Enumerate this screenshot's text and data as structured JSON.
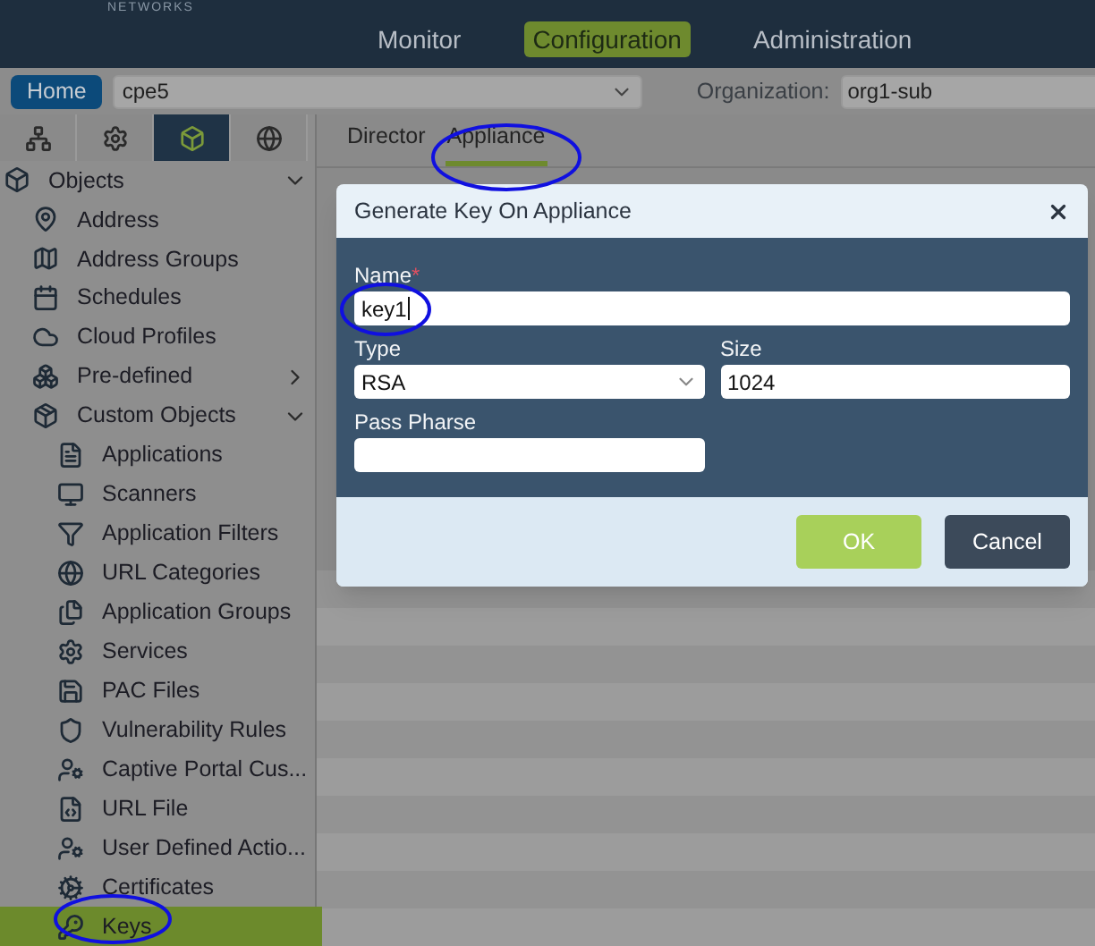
{
  "header": {
    "logo_text": "NETWORKS",
    "menu": [
      {
        "label": "Monitor",
        "selected": false
      },
      {
        "label": "Configuration",
        "selected": true
      },
      {
        "label": "Administration",
        "selected": false
      }
    ]
  },
  "toolbar": {
    "home": "Home",
    "device": "cpe5",
    "organization_label": "Organization:",
    "organization": "org1-sub"
  },
  "sidebar": {
    "tabs": [
      {
        "selected": false
      },
      {
        "selected": false
      },
      {
        "selected": true
      },
      {
        "selected": false
      }
    ],
    "tree": [
      {
        "label": "Objects",
        "expanded": true,
        "children": [
          {
            "label": "Address"
          },
          {
            "label": "Address Groups"
          },
          {
            "label": "Schedules"
          },
          {
            "label": "Cloud Profiles"
          },
          {
            "label": "Pre-defined",
            "expanded": false
          },
          {
            "label": "Custom Objects",
            "expanded": true,
            "children": [
              {
                "label": "Applications",
                "selected": false
              },
              {
                "label": "Scanners",
                "selected": false
              },
              {
                "label": "Application Filters",
                "selected": false
              },
              {
                "label": "URL Categories",
                "selected": false
              },
              {
                "label": "Application Groups",
                "selected": false
              },
              {
                "label": "Services",
                "selected": false
              },
              {
                "label": "PAC Files",
                "selected": false
              },
              {
                "label": "Vulnerability Rules",
                "selected": false
              },
              {
                "label": "Captive Portal Cus...",
                "selected": false
              },
              {
                "label": "URL File",
                "selected": false
              },
              {
                "label": "User Defined Actio...",
                "selected": false
              },
              {
                "label": "Certificates",
                "selected": false
              },
              {
                "label": "Keys",
                "selected": true
              }
            ]
          }
        ]
      }
    ]
  },
  "content": {
    "tabs": [
      {
        "label": "Director",
        "selected": false
      },
      {
        "label": "Appliance",
        "selected": true
      }
    ]
  },
  "dialog": {
    "title": "Generate Key On Appliance",
    "name": {
      "label": "Name",
      "required_mark": "*",
      "value": "key1"
    },
    "type": {
      "label": "Type",
      "value": "RSA"
    },
    "size": {
      "label": "Size",
      "value": "1024"
    },
    "pass_phrase": {
      "label": "Pass Pharse"
    },
    "buttons": [
      {
        "label": "OK",
        "kind": "primary"
      },
      {
        "label": "Cancel",
        "kind": "secondary"
      }
    ]
  }
}
